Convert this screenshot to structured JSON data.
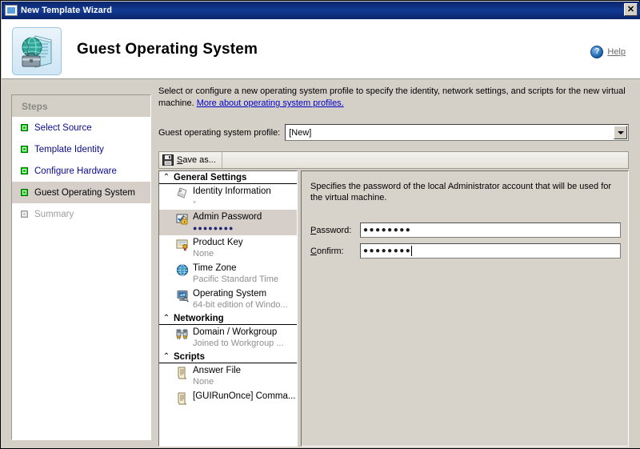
{
  "window": {
    "title": "New Template Wizard",
    "close_label": "✕",
    "icon": "window-icon"
  },
  "header": {
    "title": "Guest Operating System",
    "icon": "guest-os-server-icon",
    "help": {
      "label": "Help",
      "icon": "help-question-icon"
    }
  },
  "steps": {
    "header": "Steps",
    "items": [
      {
        "label": "Select Source",
        "state": "done"
      },
      {
        "label": "Template Identity",
        "state": "done"
      },
      {
        "label": "Configure Hardware",
        "state": "done"
      },
      {
        "label": "Guest Operating System",
        "state": "current"
      },
      {
        "label": "Summary",
        "state": "disabled"
      }
    ]
  },
  "main": {
    "intro_text_1": "Select or configure a new operating system profile to specify the identity, network settings, and scripts for the new virtual machine. ",
    "intro_link": "More about operating system profiles.",
    "profile": {
      "label": "Guest operating system profile:",
      "value": "[New]",
      "arrow_icon": "chevron-down-icon"
    },
    "toolbar": {
      "save_as_accel": "S",
      "save_as_rest": "ave as...",
      "save_icon": "floppy-save-icon"
    }
  },
  "tree": {
    "groups": [
      {
        "title": "General Settings",
        "chevron": "⌃",
        "items": [
          {
            "title": "Identity Information",
            "sub": "×",
            "sub_style": "tiny",
            "icon": "identity-tag-icon",
            "selected": false
          },
          {
            "title": "Admin Password",
            "sub": "●●●●●●●●",
            "sub_style": "dots",
            "icon": "admin-password-lock-icon",
            "selected": true
          },
          {
            "title": "Product Key",
            "sub": "None",
            "sub_style": "normal",
            "icon": "product-key-certificate-icon",
            "selected": false
          },
          {
            "title": "Time Zone",
            "sub": "Pacific Standard Time",
            "sub_style": "normal",
            "icon": "globe-clock-icon",
            "selected": false
          },
          {
            "title": "Operating System",
            "sub": "64-bit edition of Windo...",
            "sub_style": "normal",
            "icon": "operating-system-monitor-icon",
            "selected": false
          }
        ]
      },
      {
        "title": "Networking",
        "chevron": "⌃",
        "items": [
          {
            "title": "Domain / Workgroup",
            "sub": "Joined to Workgroup ...",
            "sub_style": "normal",
            "icon": "network-servers-icon",
            "selected": false
          }
        ]
      },
      {
        "title": "Scripts",
        "chevron": "⌃",
        "items": [
          {
            "title": "Answer File",
            "sub": "None",
            "sub_style": "normal",
            "icon": "script-scroll-icon",
            "selected": false
          },
          {
            "title": "[GUIRunOnce] Comma...",
            "sub": "",
            "sub_style": "normal",
            "icon": "script-scroll-icon",
            "selected": false
          }
        ]
      }
    ]
  },
  "detail": {
    "description": "Specifies the password of the local Administrator account that will be used for the virtual machine.",
    "fields": [
      {
        "label_accel": "P",
        "label_rest": "assword:",
        "value": "●●●●●●●●",
        "caret": false
      },
      {
        "label_accel": "C",
        "label_rest": "onfirm:",
        "value": "●●●●●●●●",
        "caret": true
      }
    ]
  },
  "colors": {
    "titlebar": "#0a2a7a",
    "face": "#d4d0c8",
    "selection": "#d6cfc9",
    "link": "#0000cc",
    "step_link": "#0a0a8c",
    "bullet_green": "#00d000"
  }
}
